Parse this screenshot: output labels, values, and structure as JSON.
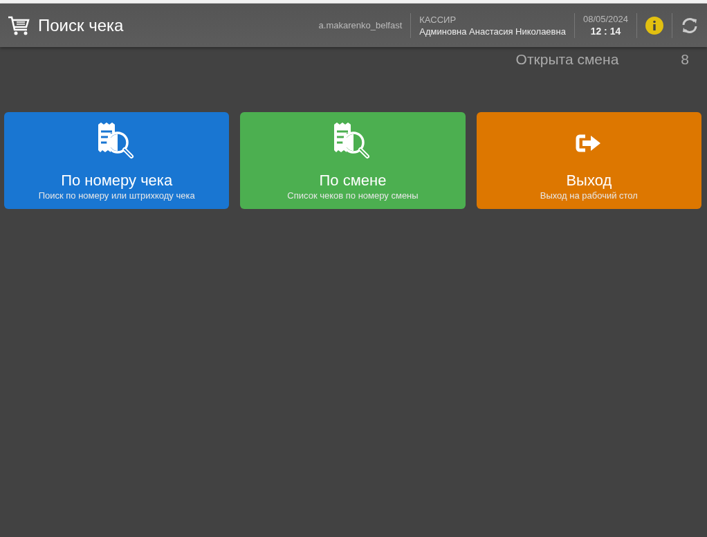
{
  "header": {
    "title": "Поиск чека",
    "login": "a.makarenko_belfast",
    "role": "КАССИР",
    "user": "Админовна Анастасия Николаевна",
    "date": "08/05/2024",
    "time": "12 : 14"
  },
  "shift": {
    "label": "Открыта смена",
    "number": "8"
  },
  "actions": [
    {
      "kind": "receipt-search",
      "color": "#1976d2",
      "title": "По номеру чека",
      "subtitle": "Поиск по номеру или штрихкоду чека"
    },
    {
      "kind": "receipt-search",
      "color": "#4caf50",
      "title": "По смене",
      "subtitle": "Список чеков по номеру смены"
    },
    {
      "kind": "exit",
      "color": "#dd7700",
      "title": "Выход",
      "subtitle": "Выход на рабочий стол"
    }
  ]
}
